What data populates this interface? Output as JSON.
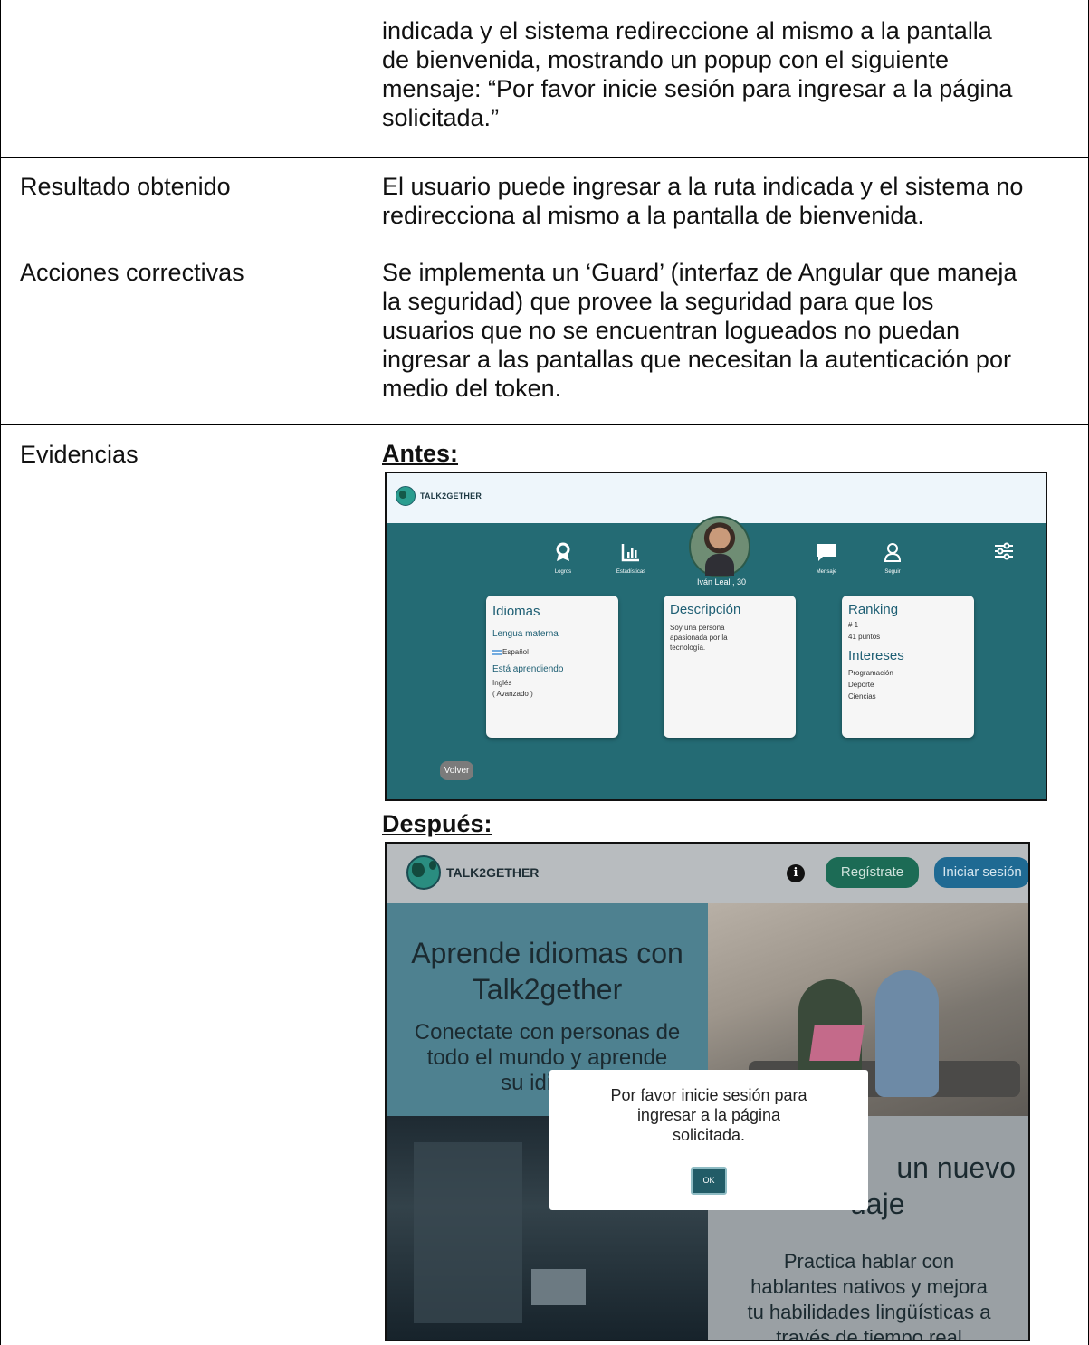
{
  "rows": [
    {
      "label": "",
      "text": [
        "indicada y el sistema redireccione al mismo a la pantalla",
        "de bienvenida, mostrando un popup con el siguiente",
        "mensaje:  “Por favor inicie sesión para ingresar a la página",
        "solicitada.”"
      ]
    },
    {
      "label": "Resultado obtenido",
      "text": [
        "El usuario puede ingresar a la ruta indicada y el sistema no",
        "redirecciona al mismo a la pantalla de bienvenida."
      ]
    },
    {
      "label": "Acciones correctivas",
      "text": [
        "Se implementa un ‘Guard’ (interfaz de Angular que maneja",
        "la seguridad) que provee la seguridad para que los",
        "usuarios que no se encuentran logueados no puedan",
        "ingresar a las pantallas que necesitan la autenticación por",
        "medio del token."
      ]
    },
    {
      "label": "Evidencias"
    }
  ],
  "evidence": {
    "before_label": "Antes:",
    "after_label": "Después:"
  },
  "before_screen": {
    "logo": "TALK2GETHER",
    "icons": [
      {
        "icon": "award-icon",
        "label": "Logros"
      },
      {
        "icon": "bar-chart-icon",
        "label": "Estadísticas"
      },
      {
        "icon": "chat-bubble-icon",
        "label": "Mensaje"
      },
      {
        "icon": "user-icon",
        "label": "Seguir"
      },
      {
        "icon": "sliders-icon",
        "label": ""
      }
    ],
    "user_name": "Iván Leal , 30",
    "card_idiomas": {
      "title": "Idiomas",
      "native_heading": "Lengua materna",
      "native_value": "Español",
      "learning_heading": "Está aprendiendo",
      "learning_value": "Inglés",
      "learning_level": "( Avanzado )"
    },
    "card_descripcion": {
      "title": "Descripción",
      "text_lines": [
        "Soy una persona",
        "apasionada por la",
        "tecnología."
      ]
    },
    "card_ranking": {
      "title": "Ranking",
      "position": "# 1",
      "points": "41 puntos",
      "interests_title": "Intereses",
      "interests": [
        "Programación",
        "Deporte",
        "Ciencias"
      ]
    },
    "back_button": "Volver"
  },
  "after_screen": {
    "logo": "TALK2GETHER",
    "register_button": "Regístrate",
    "login_button": "Iniciar sesión",
    "hero_title": [
      "Aprende idiomas con",
      "Talk2gether"
    ],
    "hero_sub": [
      "Conectate con personas de",
      "todo el mundo y aprende",
      "su idioma"
    ],
    "right_title": [
      "un nuevo",
      "uaje"
    ],
    "right_sub": [
      "Practica hablar con",
      "hablantes nativos y mejora",
      "tu habilidades lingüísticas a",
      "través de tiempo real"
    ],
    "modal_message": [
      "Por favor inicie sesión para",
      "ingresar a la página",
      "solicitada."
    ],
    "modal_ok": "OK"
  }
}
